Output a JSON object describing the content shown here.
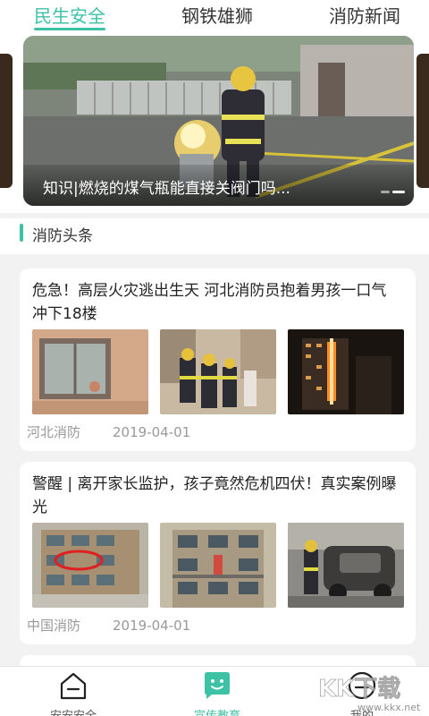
{
  "tabs": [
    {
      "label": "民生安全",
      "active": true
    },
    {
      "label": "钢铁雄狮",
      "active": false
    },
    {
      "label": "消防新闻",
      "active": false
    }
  ],
  "banner": {
    "caption": "知识|燃烧的煤气瓶能直接关阀门吗..."
  },
  "section": {
    "title": "消防头条"
  },
  "news": [
    {
      "title": "危急！高层火灾逃出生天 河北消防员抱着男孩一口气冲下18楼",
      "source": "河北消防",
      "date": "2019-04-01"
    },
    {
      "title": "警醒 | 离开家长监护，孩子竟然危机四伏！真实案例曝光",
      "source": "中国消防",
      "date": "2019-04-01"
    }
  ],
  "bottom_nav": [
    {
      "label": "安安安全",
      "icon": "home-icon",
      "active": false
    },
    {
      "label": "宣传教育",
      "icon": "chat-smile-icon",
      "active": true
    },
    {
      "label": "我的",
      "icon": "profile-icon",
      "active": false
    }
  ],
  "watermark": {
    "text": "KK下载",
    "sub": "www.kkx.net"
  },
  "colors": {
    "accent": "#3ec2a6",
    "text": "#222222",
    "muted": "#999999"
  }
}
